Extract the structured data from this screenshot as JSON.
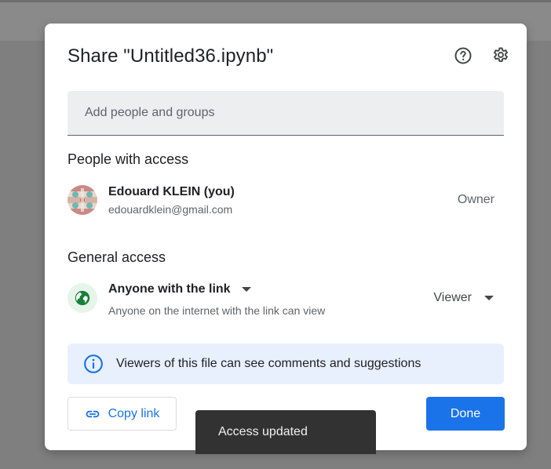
{
  "dialog": {
    "title": "Share \"Untitled36.ipynb\"",
    "help_icon": "help-circle-icon",
    "settings_icon": "gear-icon"
  },
  "add_people": {
    "placeholder": "Add people and groups",
    "value": ""
  },
  "people_with_access": {
    "heading": "People with access",
    "people": [
      {
        "name": "Edouard KLEIN (you)",
        "email": "edouardklein@gmail.com",
        "role": "Owner"
      }
    ]
  },
  "general_access": {
    "heading": "General access",
    "selected": "Anyone with the link",
    "description": "Anyone on the internet with the link can view",
    "role": "Viewer",
    "icon": "globe-icon"
  },
  "info_banner": {
    "text": "Viewers of this file can see comments and suggestions",
    "icon": "info-icon"
  },
  "actions": {
    "copy_link": "Copy link",
    "done": "Done"
  },
  "snackbar": {
    "message": "Access updated"
  },
  "colors": {
    "accent": "#1a73e8",
    "banner_bg": "#e8f0fe",
    "globe_bg": "#e6f4ea",
    "globe": "#188038",
    "snackbar_bg": "#323232",
    "overlay": "#7f7f7f"
  }
}
